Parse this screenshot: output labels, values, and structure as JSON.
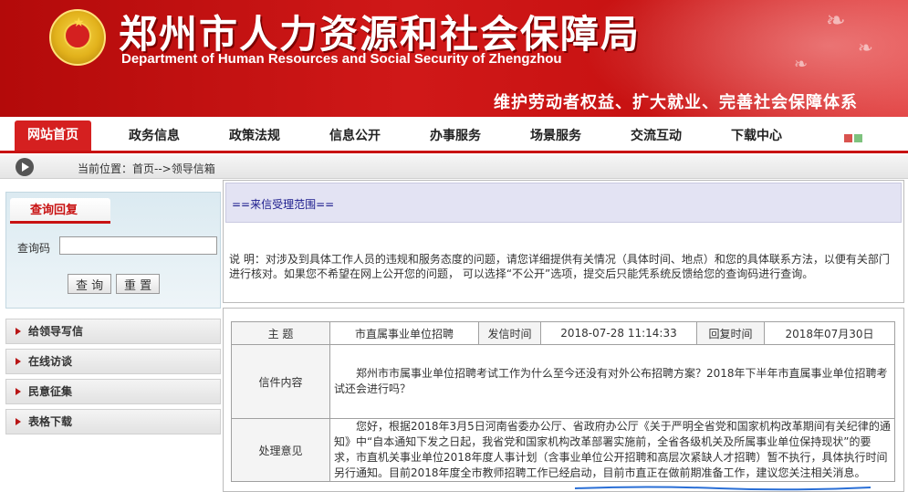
{
  "header": {
    "title": "郑州市人力资源和社会保障局",
    "subtitle": "Department of Human Resources and Social Security of Zhengzhou",
    "slogan": "维护劳动者权益、扩大就业、完善社会保障体系",
    "emblem_icon": "national-emblem-icon",
    "colors": {
      "banner": "#c81212",
      "accent": "#d52020"
    }
  },
  "nav": {
    "items": [
      "网站首页",
      "政务信息",
      "政策法规",
      "信息公开",
      "办事服务",
      "场景服务",
      "交流互动",
      "下载中心"
    ]
  },
  "breadcrumb": {
    "icon": "play-circle-icon",
    "text": "当前位置：首页-->领导信箱"
  },
  "sidebar": {
    "query_tab": "查询回复",
    "query_code_label": "查询码",
    "query_code_value": "",
    "buttons": {
      "query": "查 询",
      "reset": "重 置"
    },
    "links": [
      "给领导写信",
      "在线访谈",
      "民意征集",
      "表格下载"
    ]
  },
  "scope": {
    "heading": "==来信受理范围==",
    "description": "说 明：对涉及到具体工作人员的违规和服务态度的问题，请您详细提供有关情况（具体时间、地点）和您的具体联系方法，以便有关部门进行核对。如果您不希望在网上公开您的问题， 可以选择“不公开”选项，提交后只能凭系统反馈给您的查询码进行查询。"
  },
  "letter": {
    "subject_label": "主 题",
    "subject": "市直属事业单位招聘",
    "sent_label": "发信时间",
    "sent_time": "2018-07-28 11:14:33",
    "reply_label": "回复时间",
    "reply_time": "2018年07月30日",
    "content_label": "信件内容",
    "content": "郑州市市属事业单位招聘考试工作为什么至今还没有对外公布招聘方案？2018年下半年市直属事业单位招聘考试还会进行吗？",
    "reply_opinion_label": "处理意见",
    "reply_text": "您好，根据2018年3月5日河南省委办公厅、省政府办公厅《关于严明全省党和国家机构改革期间有关纪律的通知》中“自本通知下发之日起，我省党和国家机构改革部署实施前，全省各级机关及所属事业单位保持现状”的要求，市直机关事业单位2018年度人事计划（含事业单位公开招聘和高层次紧缺人才招聘）暂不执行，具体执行时间另行通知。目前2018年度全市教师招聘工作已经启动，目前市直正在做前期准备工作，建议您关注相关消息。"
  }
}
